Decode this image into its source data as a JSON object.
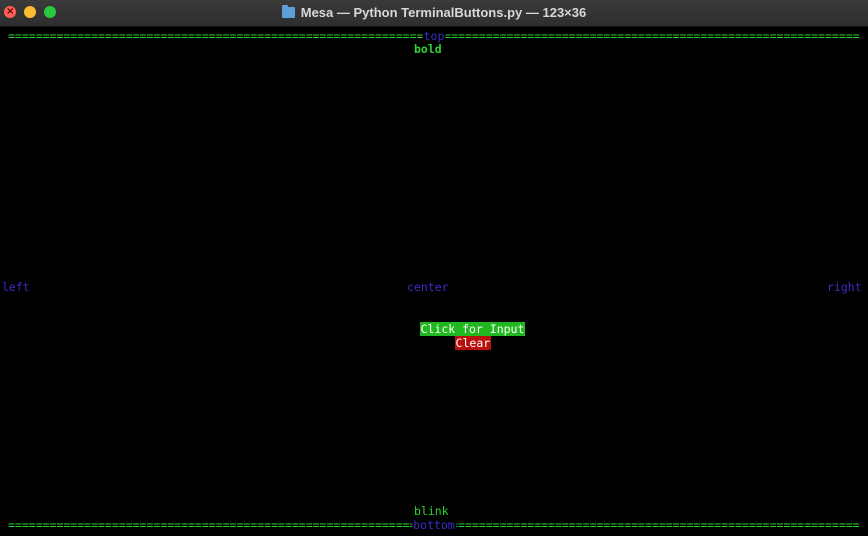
{
  "window": {
    "title": "Mesa — Python TerminalButtons.py — 123×36",
    "close_glyph": "×"
  },
  "terminal": {
    "top_rule_label": "top",
    "bottom_rule_label": "bottom",
    "bold_text": "bold",
    "left_text": "left",
    "center_text": "center",
    "right_text": "right",
    "input_button_label": "Click for Input",
    "clear_button_label": "Clear",
    "blink_text": "blink"
  },
  "colors": {
    "rule_green": "#2fd22f",
    "label_blue": "#3a2cc8",
    "button_green": "#1fb81f",
    "button_red": "#b80f0f"
  }
}
